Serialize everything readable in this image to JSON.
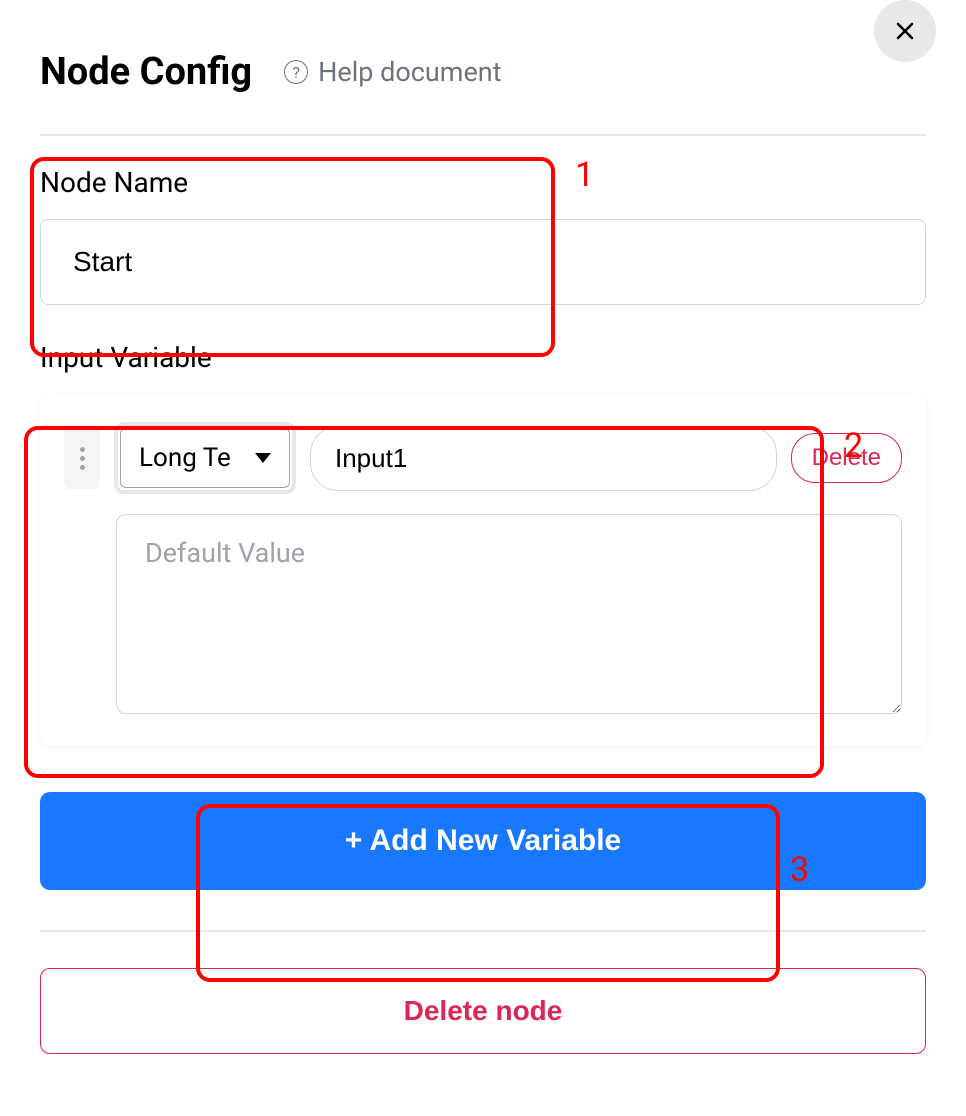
{
  "header": {
    "title": "Node Config",
    "help_label": "Help document"
  },
  "node_name": {
    "label": "Node Name",
    "value": "Start"
  },
  "input_variable": {
    "label": "Input Variable",
    "variables": [
      {
        "type_label": "Long Te",
        "name": "Input1",
        "delete_label": "Delete",
        "default_placeholder": "Default Value",
        "default_value": ""
      }
    ]
  },
  "actions": {
    "add_variable_label": "+ Add New Variable",
    "delete_node_label": "Delete node"
  },
  "annotations": {
    "a1": "1",
    "a2": "2",
    "a3": "3"
  }
}
